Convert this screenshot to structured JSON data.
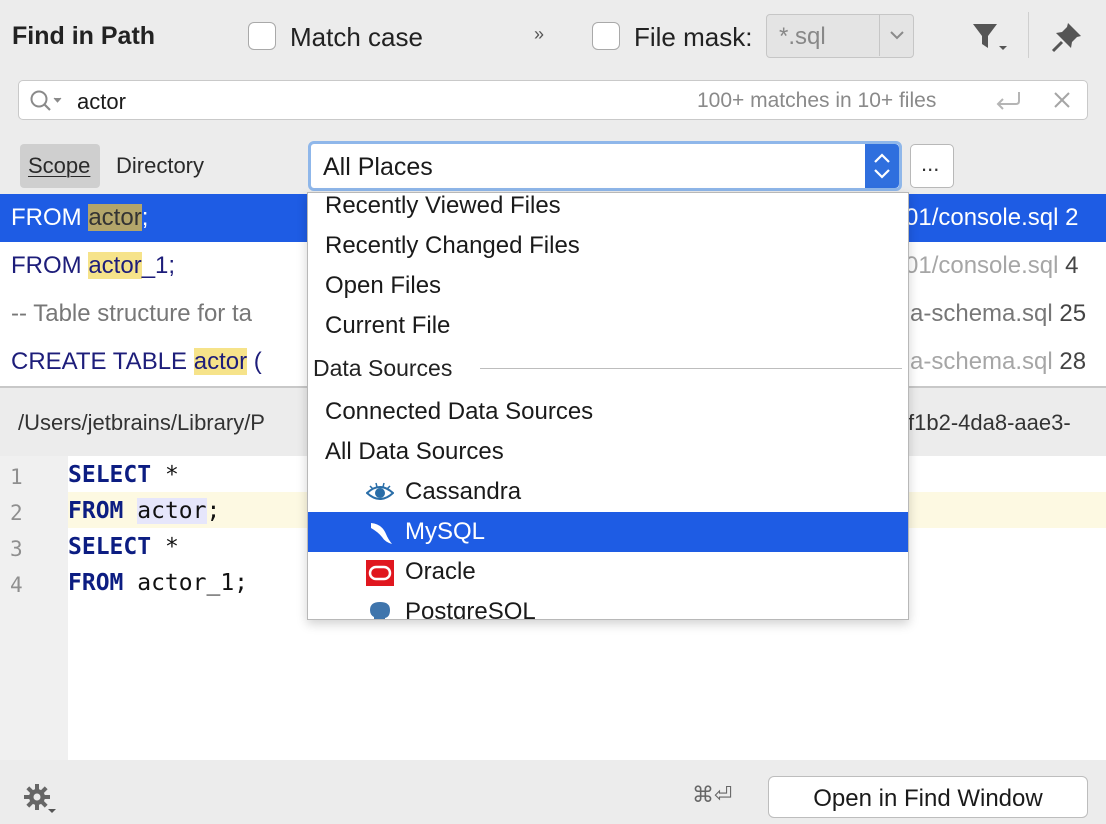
{
  "header": {
    "title": "Find in Path",
    "match_case": {
      "label": "Match case",
      "checked": false
    },
    "more_glyph": "»",
    "file_mask": {
      "label": "File mask:",
      "checked": false,
      "value": "*.sql"
    }
  },
  "search": {
    "query": "actor",
    "match_count": "100+ matches in 10+ files"
  },
  "scope": {
    "tabs": [
      "Scope",
      "Directory"
    ],
    "active_tab": "Scope",
    "selected": "All Places",
    "more_label": "..."
  },
  "results": [
    {
      "code_before": "FROM ",
      "match": "actor",
      "code_after": ";",
      "path": "01/console.sql",
      "line": "2",
      "selected": true
    },
    {
      "code_before": "FROM ",
      "match": "actor",
      "code_after": "_1;",
      "path": "01/console.sql",
      "line": "4",
      "selected": false
    },
    {
      "code_before": "-- Table structure for ta",
      "match": "",
      "code_after": "",
      "path": "a-schema.sql",
      "line": "25",
      "selected": false
    },
    {
      "code_before": "CREATE TABLE ",
      "match": "actor",
      "code_after": " (",
      "path": "a-schema.sql",
      "line": "28",
      "selected": false
    }
  ],
  "file_path": {
    "left": "/Users/jetbrains/Library/P",
    "right": "f1b2-4da8-aae3-"
  },
  "editor": {
    "lines": [
      {
        "num": "1",
        "kw": "SELECT",
        "rest": " *"
      },
      {
        "num": "2",
        "kw": "FROM",
        "rest": " actor;"
      },
      {
        "num": "3",
        "kw": "SELECT",
        "rest": " *"
      },
      {
        "num": "4",
        "kw": "FROM",
        "rest": " actor_1;"
      }
    ],
    "current_line": "2"
  },
  "dropdown": {
    "items_top": [
      "Recently Viewed Files",
      "Recently Changed Files",
      "Open Files",
      "Current File"
    ],
    "group_label": "Data Sources",
    "items_mid": [
      "Connected Data Sources",
      "All Data Sources"
    ],
    "sources": [
      {
        "label": "Cassandra",
        "icon": "cassandra-eye-icon"
      },
      {
        "label": "MySQL",
        "icon": "mysql-dolphin-icon",
        "selected": true
      },
      {
        "label": "Oracle",
        "icon": "oracle-logo-icon"
      },
      {
        "label": "PostgreSQL",
        "icon": "postgresql-elephant-icon"
      }
    ]
  },
  "footer": {
    "shortcut": "⌘⏎",
    "open_button": "Open in Find Window"
  },
  "colors": {
    "selection": "#1e5ce4",
    "match_highlight": "#f6e38a",
    "keyword": "#0c1d82",
    "focus_ring": "#8fb7ea"
  }
}
